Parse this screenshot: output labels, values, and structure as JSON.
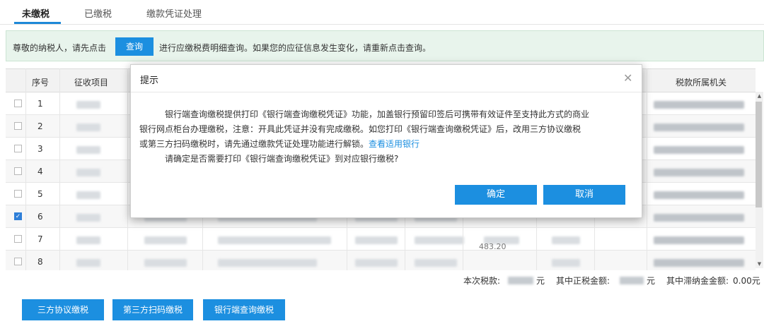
{
  "tabs": [
    {
      "label": "未缴税",
      "active": true
    },
    {
      "label": "已缴税",
      "active": false
    },
    {
      "label": "缴款凭证处理",
      "active": false
    }
  ],
  "notice": {
    "prefix": "尊敬的纳税人，请先点击",
    "query_button": "查询",
    "suffix": "进行应缴税费明细查询。如果您的应征信息发生变化，请重新点击查询。"
  },
  "table": {
    "headers": [
      "序号",
      "征收项目",
      "税款所属机关"
    ],
    "rows": [
      {
        "no": "1",
        "checked": false
      },
      {
        "no": "2",
        "checked": false
      },
      {
        "no": "3",
        "checked": false
      },
      {
        "no": "4",
        "checked": false
      },
      {
        "no": "5",
        "checked": false
      },
      {
        "no": "6",
        "checked": true
      },
      {
        "no": "7",
        "checked": false
      },
      {
        "no": "8",
        "checked": false
      }
    ],
    "row8_amount": "483.20"
  },
  "summary": {
    "tax_label": "本次税款:",
    "tax_unit": "元",
    "principal_label": "其中正税金额:",
    "principal_unit": "元",
    "late_fee_label": "其中滞纳金金额:",
    "late_fee_value": "0.00元"
  },
  "actions": {
    "three_party": "三方协议缴税",
    "scan_pay": "第三方扫码缴税",
    "bank_counter": "银行端查询缴税"
  },
  "dialog": {
    "title": "提示",
    "line1": "银行端查询缴税提供打印《银行端查询缴税凭证》功能，加盖银行预留印签后可携带有效证件至支持此方式的商业",
    "line2": "银行网点柜台办理缴税，注意：开具此凭证并没有完成缴税。如您打印《银行端查询缴税凭证》后，改用三方协议缴税",
    "line3": "或第三方扫码缴税时，请先通过缴款凭证处理功能进行解锁。",
    "link": "查看适用银行",
    "line4": "请确定是否需要打印《银行端查询缴税凭证》到对应银行缴税?",
    "confirm": "确定",
    "cancel": "取消"
  },
  "colors": {
    "accent": "#1c8fe0",
    "notice_bg": "#e8f4ec",
    "checkbox_checked": "#2f7fd8"
  }
}
